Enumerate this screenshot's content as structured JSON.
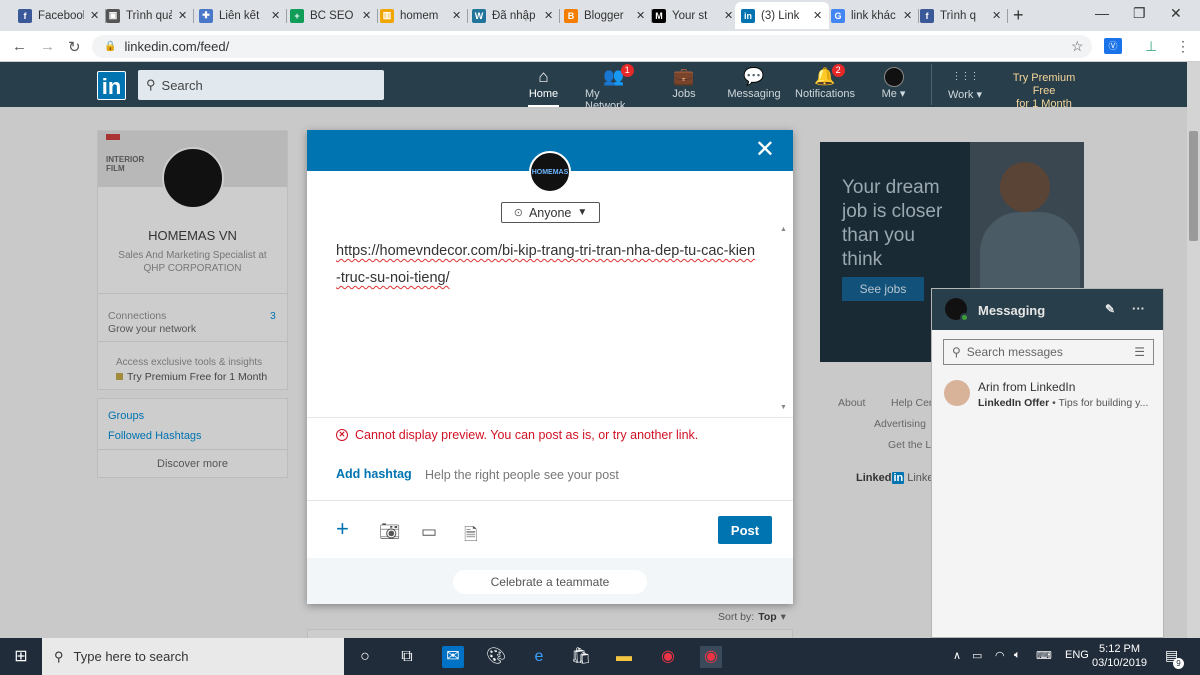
{
  "browser": {
    "tabs": [
      {
        "label": "Facebook",
        "fav_color": "#3b5998",
        "fav_glyph": "f"
      },
      {
        "label": "Trình quản",
        "fav_color": "#555555",
        "fav_glyph": "▣"
      },
      {
        "label": "Liên kết",
        "fav_color": "#4a78c9",
        "fav_glyph": "✚"
      },
      {
        "label": "BC SEO",
        "fav_color": "#0f9d58",
        "fav_glyph": "+"
      },
      {
        "label": "homem",
        "fav_color": "#f0a500",
        "fav_glyph": "▥"
      },
      {
        "label": "Đã nhập",
        "fav_color": "#21759b",
        "fav_glyph": "W"
      },
      {
        "label": "Blogger",
        "fav_color": "#f57d00",
        "fav_glyph": "B"
      },
      {
        "label": "Your st",
        "fav_color": "#000000",
        "fav_glyph": "M"
      },
      {
        "label": "(3) Link",
        "fav_color": "#0073b1",
        "fav_glyph": "in"
      },
      {
        "label": "link khác",
        "fav_color": "#4285f4",
        "fav_glyph": "G"
      },
      {
        "label": "Trình q",
        "fav_color": "#3b5998",
        "fav_glyph": "f"
      }
    ],
    "active_tab_index": 8,
    "url": "linkedin.com/feed/"
  },
  "nav": {
    "search_placeholder": "Search",
    "items": [
      {
        "label": "Home",
        "icon": "home-icon",
        "glyph": "⌂",
        "badge": ""
      },
      {
        "label": "My Network",
        "icon": "network-icon",
        "glyph": "👥",
        "badge": "1"
      },
      {
        "label": "Jobs",
        "icon": "briefcase-icon",
        "glyph": "💼",
        "badge": ""
      },
      {
        "label": "Messaging",
        "icon": "messaging-icon",
        "glyph": "💬",
        "badge": ""
      },
      {
        "label": "Notifications",
        "icon": "bell-icon",
        "glyph": "🔔",
        "badge": "2"
      },
      {
        "label": "Me ▾",
        "icon": "avatar-icon",
        "glyph": "●",
        "badge": ""
      },
      {
        "label": "Work ▾",
        "icon": "grid-icon",
        "glyph": "⋮⋮⋮",
        "badge": ""
      }
    ],
    "premium_line1": "Try Premium Free",
    "premium_line2": "for 1 Month"
  },
  "profile": {
    "banner_text": "INTERIOR FILM",
    "name": "HOMEMAS VN",
    "headline": "Sales And Marketing Specialist at QHP CORPORATION",
    "connections_label": "Connections",
    "connections_count": "3",
    "grow_label": "Grow your network",
    "access_label": "Access exclusive tools & insights",
    "premium_label": "Try Premium Free for 1 Month",
    "groups": "Groups",
    "hashtags": "Followed Hashtags",
    "discover": "Discover more"
  },
  "ad": {
    "line1": "Your dream",
    "line2": "job is closer",
    "line3": "than you",
    "line4": "think",
    "button": "See jobs"
  },
  "footer": {
    "about": "About",
    "help": "Help Center",
    "advertising": "Advertising",
    "get": "Get the LinkedIn app",
    "brand": "Linked",
    "brand_in": "in",
    "brand_tail": "LinkedIn Corporation"
  },
  "feed": {
    "sort_label": "Sort by:",
    "sort_value": "Top"
  },
  "modal": {
    "avatar_text": "HOMEMAS",
    "visibility": "Anyone",
    "post_text": "https://homevndecor.com/bi-kip-trang-tri-tran-nha-dep-tu-cac-kien-truc-su-noi-tieng/",
    "error": "Cannot display preview. You can post as is, or try another link.",
    "add_hashtag": "Add hashtag",
    "hashtag_hint": "Help the right people see your post",
    "post_button": "Post",
    "celebrate": "Celebrate a teammate"
  },
  "messaging": {
    "title": "Messaging",
    "search_placeholder": "Search messages",
    "item_name": "Arin from LinkedIn",
    "item_preview_bold": "LinkedIn Offer",
    "item_preview": " • Tips for building y..."
  },
  "taskbar": {
    "search_placeholder": "Type here to search",
    "lang": "ENG",
    "time": "5:12 PM",
    "date": "03/10/2019",
    "notif_count": "9"
  }
}
